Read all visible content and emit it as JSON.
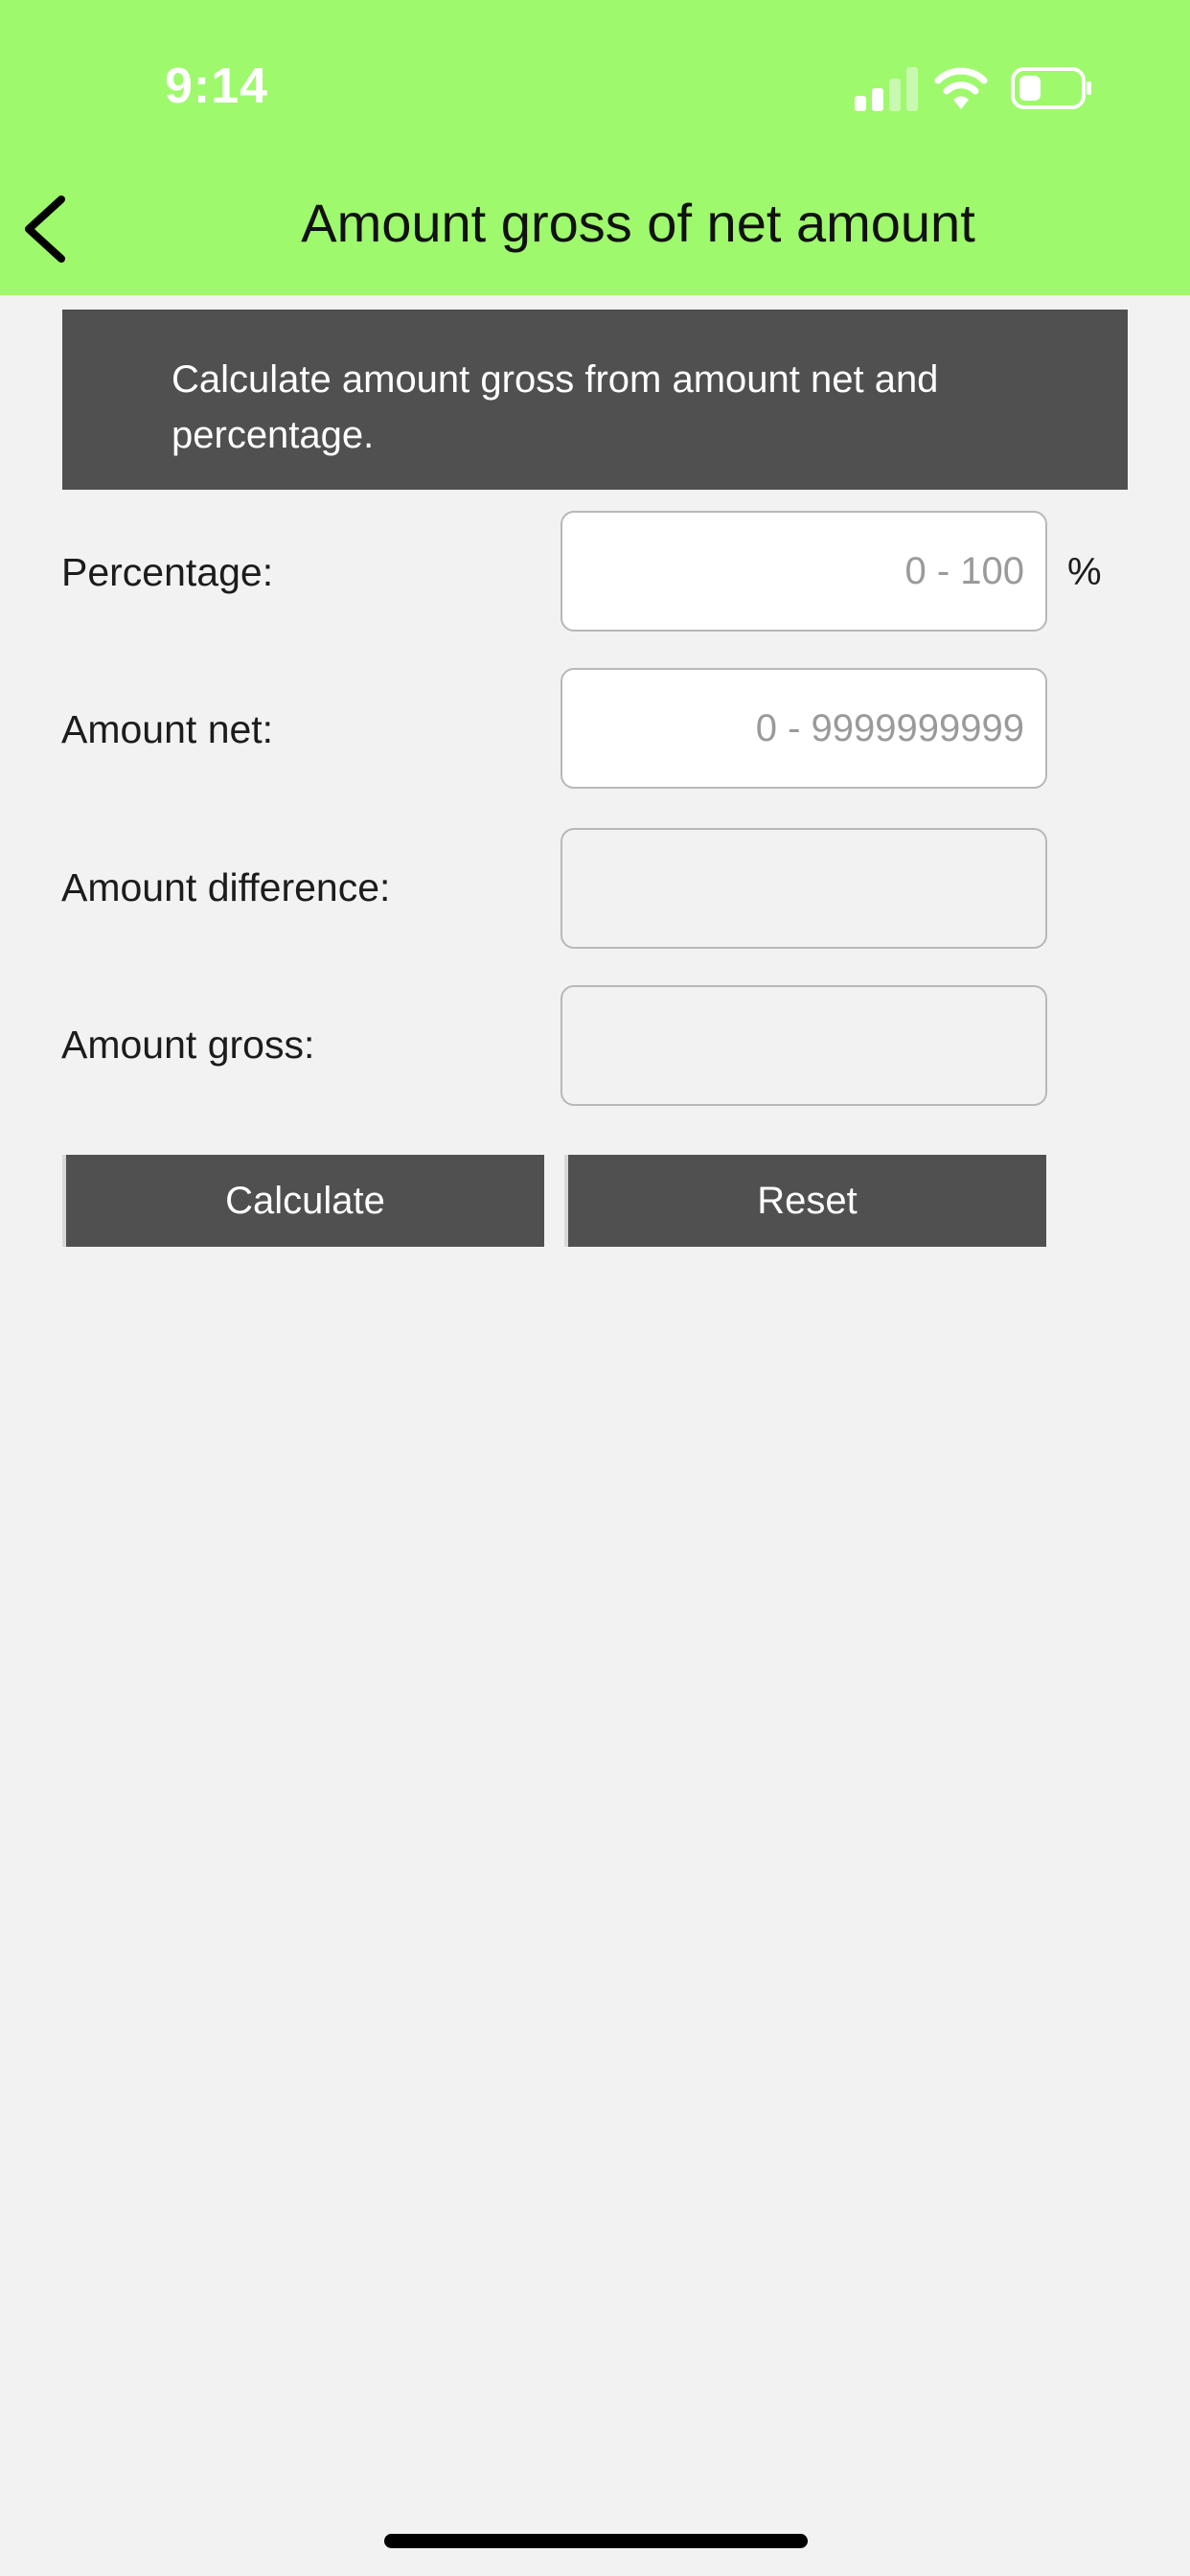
{
  "status_bar": {
    "time": "9:14",
    "signal_icon": "cellular-signal-icon",
    "wifi_icon": "wifi-icon",
    "battery_icon": "battery-icon"
  },
  "nav": {
    "title": "Amount gross of net amount",
    "back_icon": "chevron-left-icon"
  },
  "info": {
    "text": "Calculate amount gross from amount net and percentage."
  },
  "form": {
    "percentage_label": "Percentage:",
    "percentage_value": "",
    "percentage_placeholder": "0 - 100",
    "percentage_unit": "%",
    "amount_net_label": "Amount net:",
    "amount_net_value": "",
    "amount_net_placeholder": "0 - 9999999999",
    "amount_difference_label": "Amount difference:",
    "amount_difference_value": "",
    "amount_gross_label": "Amount gross:",
    "amount_gross_value": ""
  },
  "buttons": {
    "calculate": "Calculate",
    "reset": "Reset"
  },
  "colors": {
    "header_bg": "#9ef96c",
    "dark_panel": "#505050",
    "page_bg": "#f2f2f2"
  }
}
